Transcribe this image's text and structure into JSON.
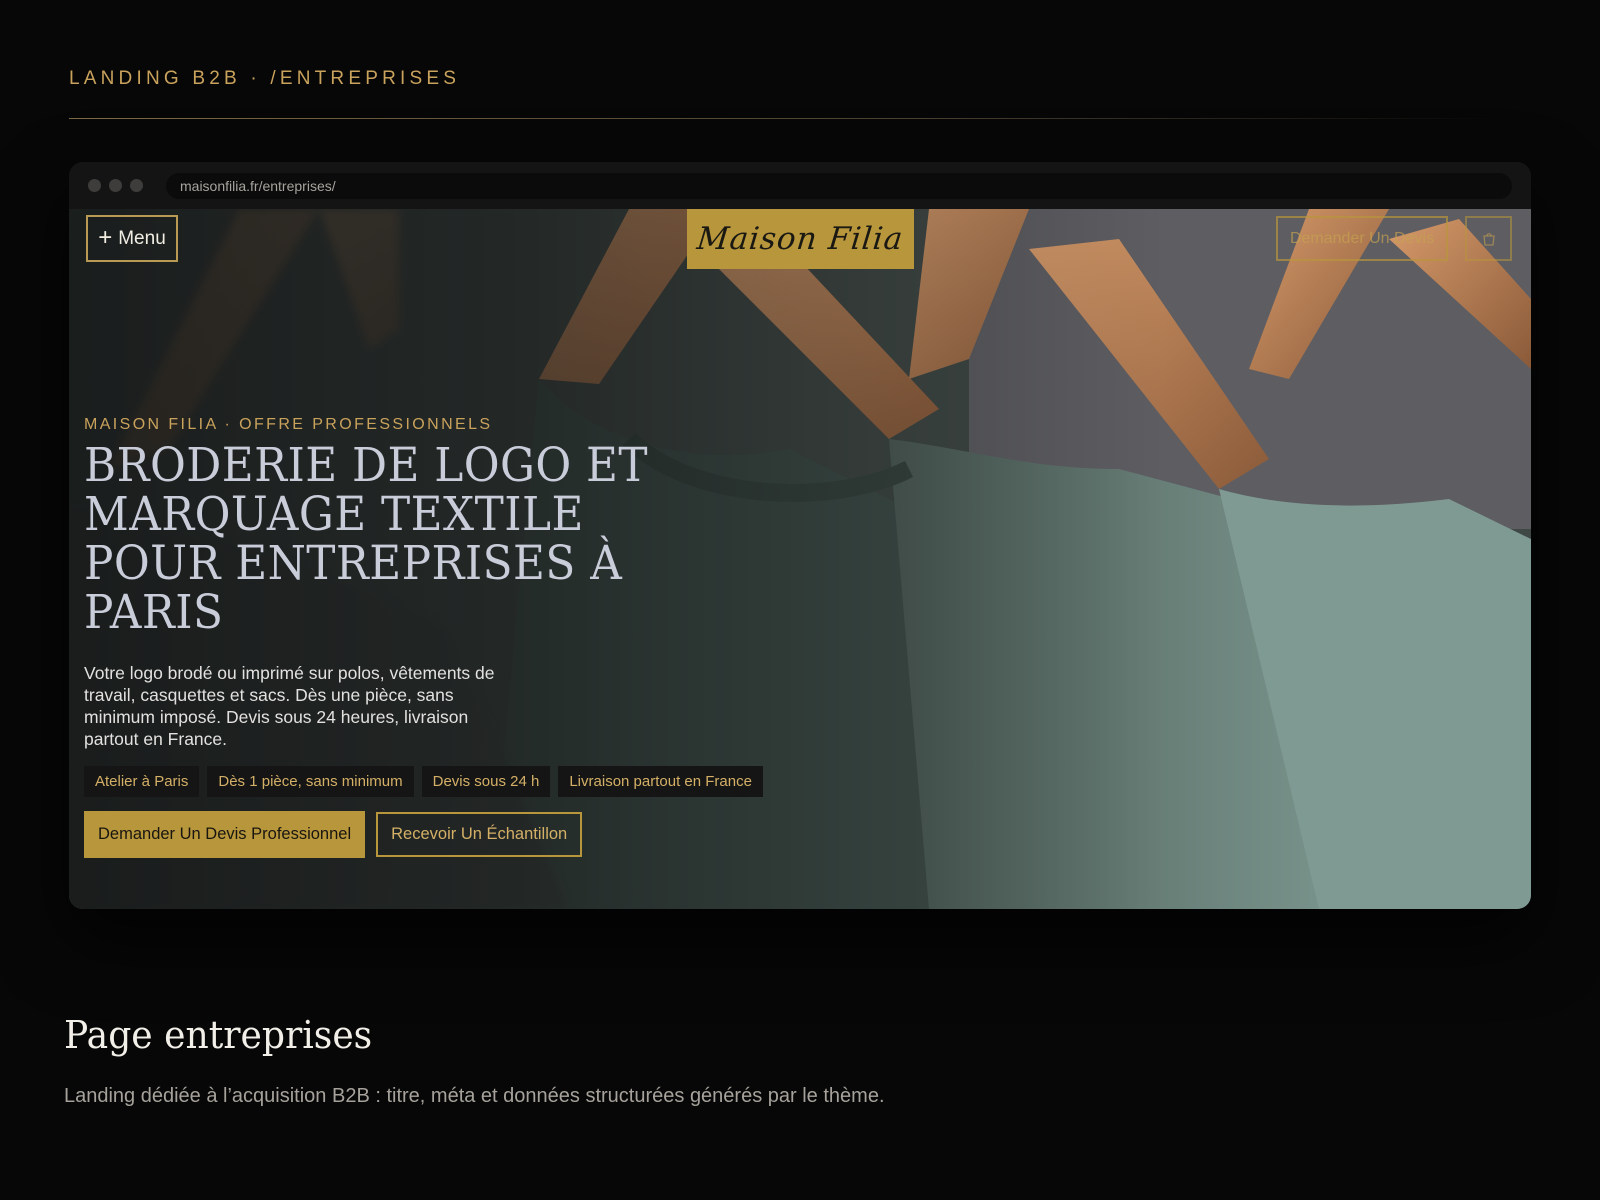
{
  "section_label": "LANDING B2B · /ENTREPRISES",
  "browser": {
    "url": "maisonfilia.fr/entreprises/"
  },
  "site": {
    "menu_label": "Menu",
    "logo_text": "Maison Filia",
    "nav_quote_label": "Demander Un Devis",
    "cart_icon": "bag-icon"
  },
  "hero": {
    "eyebrow": "MAISON FILIA · OFFRE PROFESSIONNELS",
    "headline": "BRODERIE DE LOGO ET MARQUAGE TEXTILE POUR ENTREPRISES À PARIS",
    "lede": "Votre logo brodé ou imprimé sur polos, vêtements de travail, casquettes et sacs. Dès une pièce, sans minimum imposé. Devis sous 24 heures, livraison partout en France.",
    "chips": [
      "Atelier à Paris",
      "Dès 1 pièce, sans minimum",
      "Devis sous 24 h",
      "Livraison partout en France"
    ],
    "cta_primary": "Demander Un Devis Professionnel",
    "cta_secondary": "Recevoir Un Échantillon"
  },
  "caption": {
    "title": "Page entreprises",
    "text": "Landing dédiée à l’acquisition B2B : titre, méta et données structurées générés par le thème."
  },
  "colors": {
    "background": "#070707",
    "gold": "#b8963c",
    "gold_text": "#c9a25c",
    "headline": "#c9ccd9"
  }
}
